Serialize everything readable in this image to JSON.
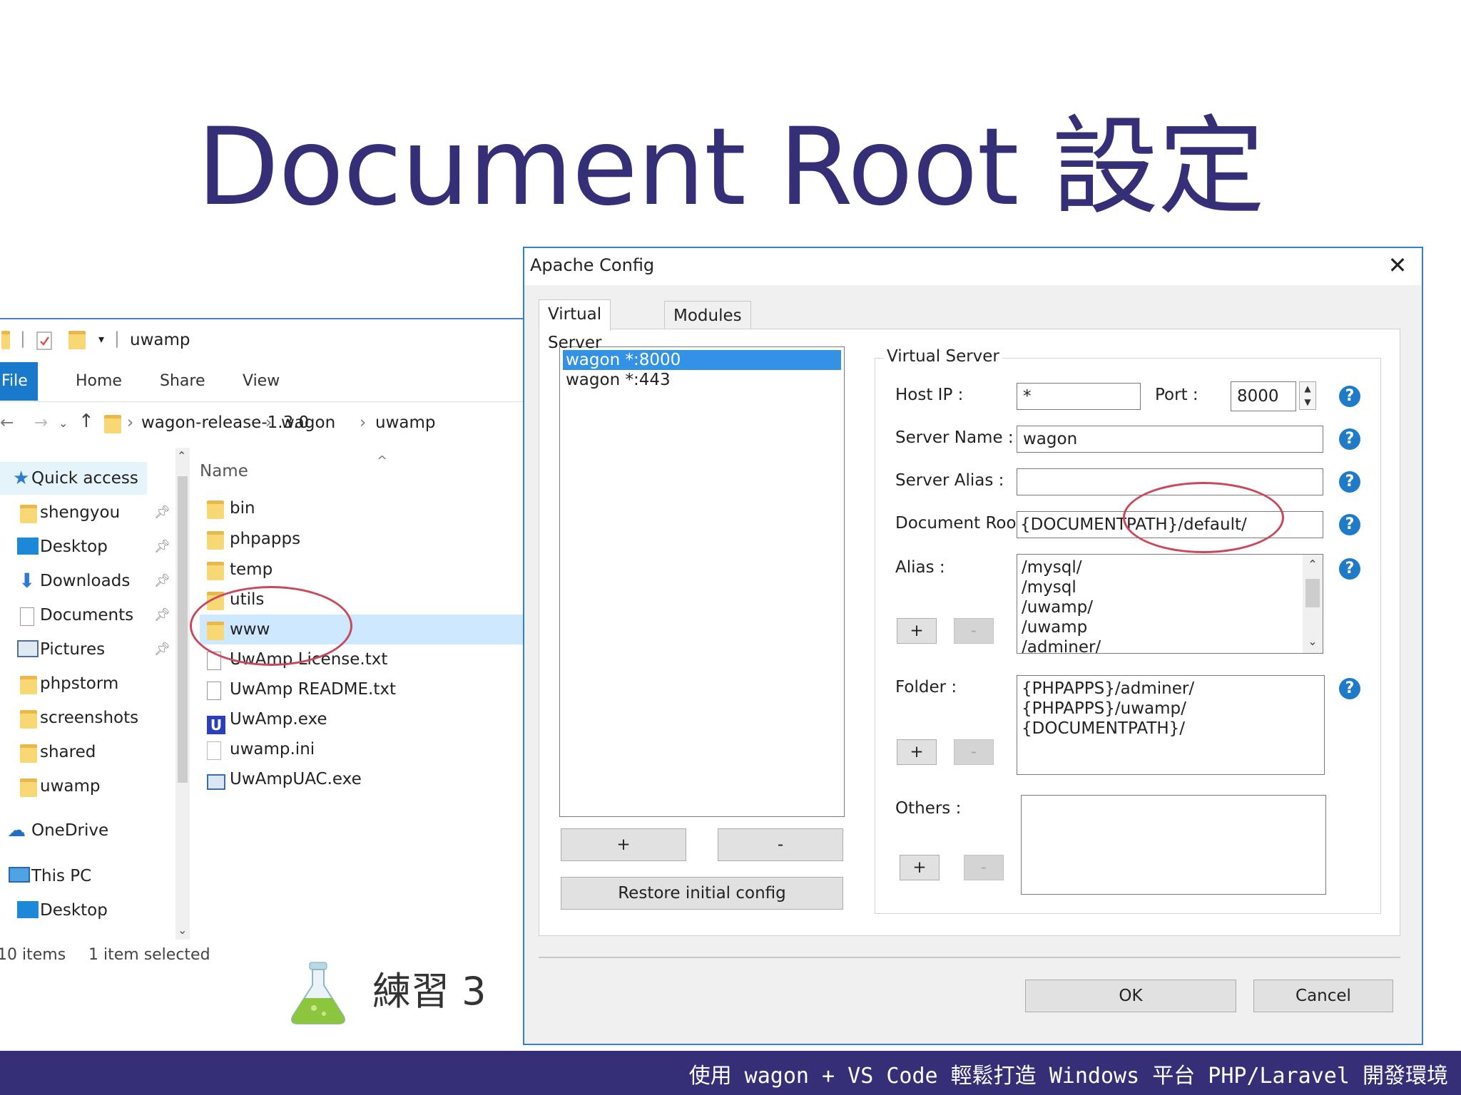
{
  "slide": {
    "title": "Document Root 設定",
    "exercise_label": "練習 3",
    "footer": "使用 wagon + VS Code 輕鬆打造 Windows 平台 PHP/Laravel 開發環境"
  },
  "explorer": {
    "window_title": "uwamp",
    "ribbon_tabs": [
      "File",
      "Home",
      "Share",
      "View"
    ],
    "breadcrumbs": [
      "wagon-release-1.3.0",
      "wagon",
      "uwamp"
    ],
    "nav_items": [
      {
        "label": "Quick access",
        "icon": "star-icon"
      },
      {
        "label": "shengyou",
        "icon": "folder-icon"
      },
      {
        "label": "Desktop",
        "icon": "desktop-icon"
      },
      {
        "label": "Downloads",
        "icon": "download-icon"
      },
      {
        "label": "Documents",
        "icon": "documents-icon"
      },
      {
        "label": "Pictures",
        "icon": "pictures-icon"
      },
      {
        "label": "phpstorm",
        "icon": "folder-icon"
      },
      {
        "label": "screenshots",
        "icon": "folder-icon"
      },
      {
        "label": "shared",
        "icon": "folder-icon"
      },
      {
        "label": "uwamp",
        "icon": "folder-icon"
      },
      {
        "label": "OneDrive",
        "icon": "cloud-icon"
      },
      {
        "label": "This PC",
        "icon": "pc-icon"
      },
      {
        "label": "Desktop",
        "icon": "desktop-icon"
      }
    ],
    "column_header": "Name",
    "files": [
      {
        "name": "bin",
        "type": "folder"
      },
      {
        "name": "phpapps",
        "type": "folder"
      },
      {
        "name": "temp",
        "type": "folder"
      },
      {
        "name": "utils",
        "type": "folder"
      },
      {
        "name": "www",
        "type": "folder",
        "selected": true
      },
      {
        "name": "UwAmp License.txt",
        "type": "text"
      },
      {
        "name": "UwAmp README.txt",
        "type": "text"
      },
      {
        "name": "UwAmp.exe",
        "type": "exe"
      },
      {
        "name": "uwamp.ini",
        "type": "ini"
      },
      {
        "name": "UwAmpUAC.exe",
        "type": "exe"
      }
    ],
    "status_items": "10 items",
    "status_selected": "1 item selected"
  },
  "dialog": {
    "title": "Apache Config",
    "close_label": "✕",
    "tabs": [
      "Virtual Server",
      "Modules"
    ],
    "vs_list": [
      "wagon *:8000",
      "wagon *:443"
    ],
    "add_label": "+",
    "remove_label": "-",
    "restore_label": "Restore initial config",
    "group_title": "Virtual Server",
    "host_ip_label": "Host IP :",
    "host_ip_value": "*",
    "port_label": "Port :",
    "port_value": "8000",
    "server_name_label": "Server Name :",
    "server_name_value": "wagon",
    "server_alias_label": "Server Alias :",
    "server_alias_value": "",
    "document_root_label": "Document Root",
    "document_root_value": "{DOCUMENTPATH}/default/",
    "alias_label": "Alias :",
    "alias_items": [
      "/mysql/",
      "/mysql",
      "/uwamp/",
      "/uwamp",
      "/adminer/"
    ],
    "folder_label": "Folder :",
    "folder_items": [
      "{PHPAPPS}/adminer/",
      "{PHPAPPS}/uwamp/",
      "{DOCUMENTPATH}/"
    ],
    "others_label": "Others :",
    "help_label": "?",
    "ok_label": "OK",
    "cancel_label": "Cancel"
  }
}
